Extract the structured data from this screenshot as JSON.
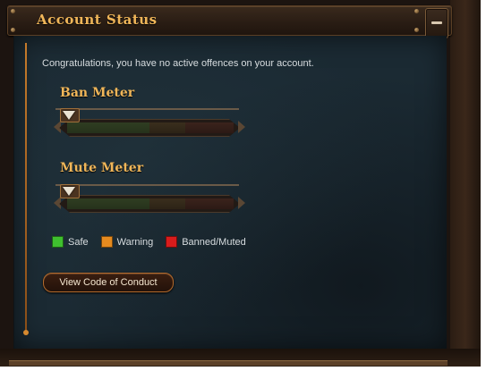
{
  "header": {
    "title": "Account Status",
    "collapse_icon": "minus-icon"
  },
  "message": "Congratulations, you have no active offences on your account.",
  "meters": [
    {
      "label": "Ban Meter",
      "level": 0
    },
    {
      "label": "Mute Meter",
      "level": 0
    }
  ],
  "legend": [
    {
      "label": "Safe",
      "color": "#3fbf2f"
    },
    {
      "label": "Warning",
      "color": "#e58a1f"
    },
    {
      "label": "Banned/Muted",
      "color": "#d81c1c"
    }
  ],
  "actions": {
    "code_of_conduct": "View Code of Conduct"
  },
  "colors": {
    "accent": "#f0b659",
    "panel": "#1b2a33"
  }
}
